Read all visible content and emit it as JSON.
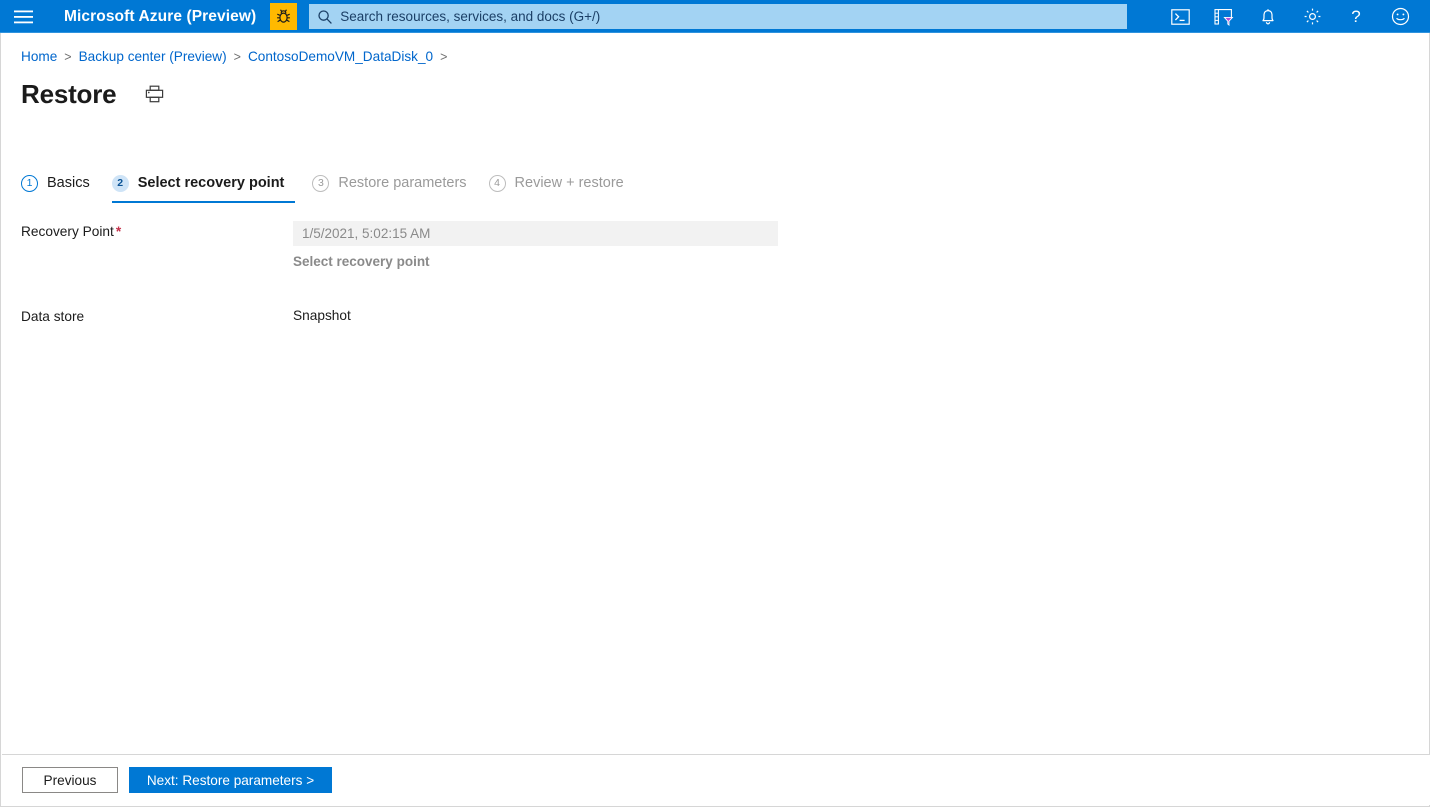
{
  "topbar": {
    "menu_icon": "hamburger-icon",
    "brand": "Microsoft Azure (Preview)",
    "bug_icon": "bug-icon",
    "search": {
      "icon": "search-icon",
      "placeholder": "Search resources, services, and docs (G+/)",
      "value": ""
    },
    "icons": [
      {
        "name": "cloud-shell-icon"
      },
      {
        "name": "directory-filter-icon"
      },
      {
        "name": "notifications-bell-icon"
      },
      {
        "name": "settings-gear-icon"
      },
      {
        "name": "help-question-icon"
      },
      {
        "name": "feedback-smiley-icon"
      }
    ]
  },
  "breadcrumb": {
    "items": [
      {
        "label": "Home",
        "link": true
      },
      {
        "label": "Backup center (Preview)",
        "link": true
      },
      {
        "label": "ContosoDemoVM_DataDisk_0",
        "link": true
      }
    ],
    "separator": ">"
  },
  "header": {
    "title": "Restore",
    "print_icon": "printer-icon"
  },
  "wizard": {
    "steps": [
      {
        "number": "1",
        "label": "Basics",
        "state": "done"
      },
      {
        "number": "2",
        "label": "Select recovery point",
        "state": "active"
      },
      {
        "number": "3",
        "label": "Restore parameters",
        "state": "disabled"
      },
      {
        "number": "4",
        "label": "Review + restore",
        "state": "disabled"
      }
    ]
  },
  "form": {
    "recovery_point": {
      "label": "Recovery Point",
      "required_marker": "*",
      "value": "1/5/2021, 5:02:15 AM",
      "placeholder": "1/5/2021, 5:02:15 AM",
      "action_link": "Select recovery point"
    },
    "data_store": {
      "label": "Data store",
      "value": "Snapshot"
    }
  },
  "footer": {
    "previous_label": "Previous",
    "next_label": "Next: Restore parameters >"
  },
  "colors": {
    "azure_blue": "#0078d4",
    "search_bg": "#a3d3f3",
    "bug_amber": "#ffb900",
    "link_blue": "#0066cc",
    "required_red": "#c4314b",
    "disabled_gray": "#9a9a9a",
    "input_bg": "#f2f2f2"
  }
}
